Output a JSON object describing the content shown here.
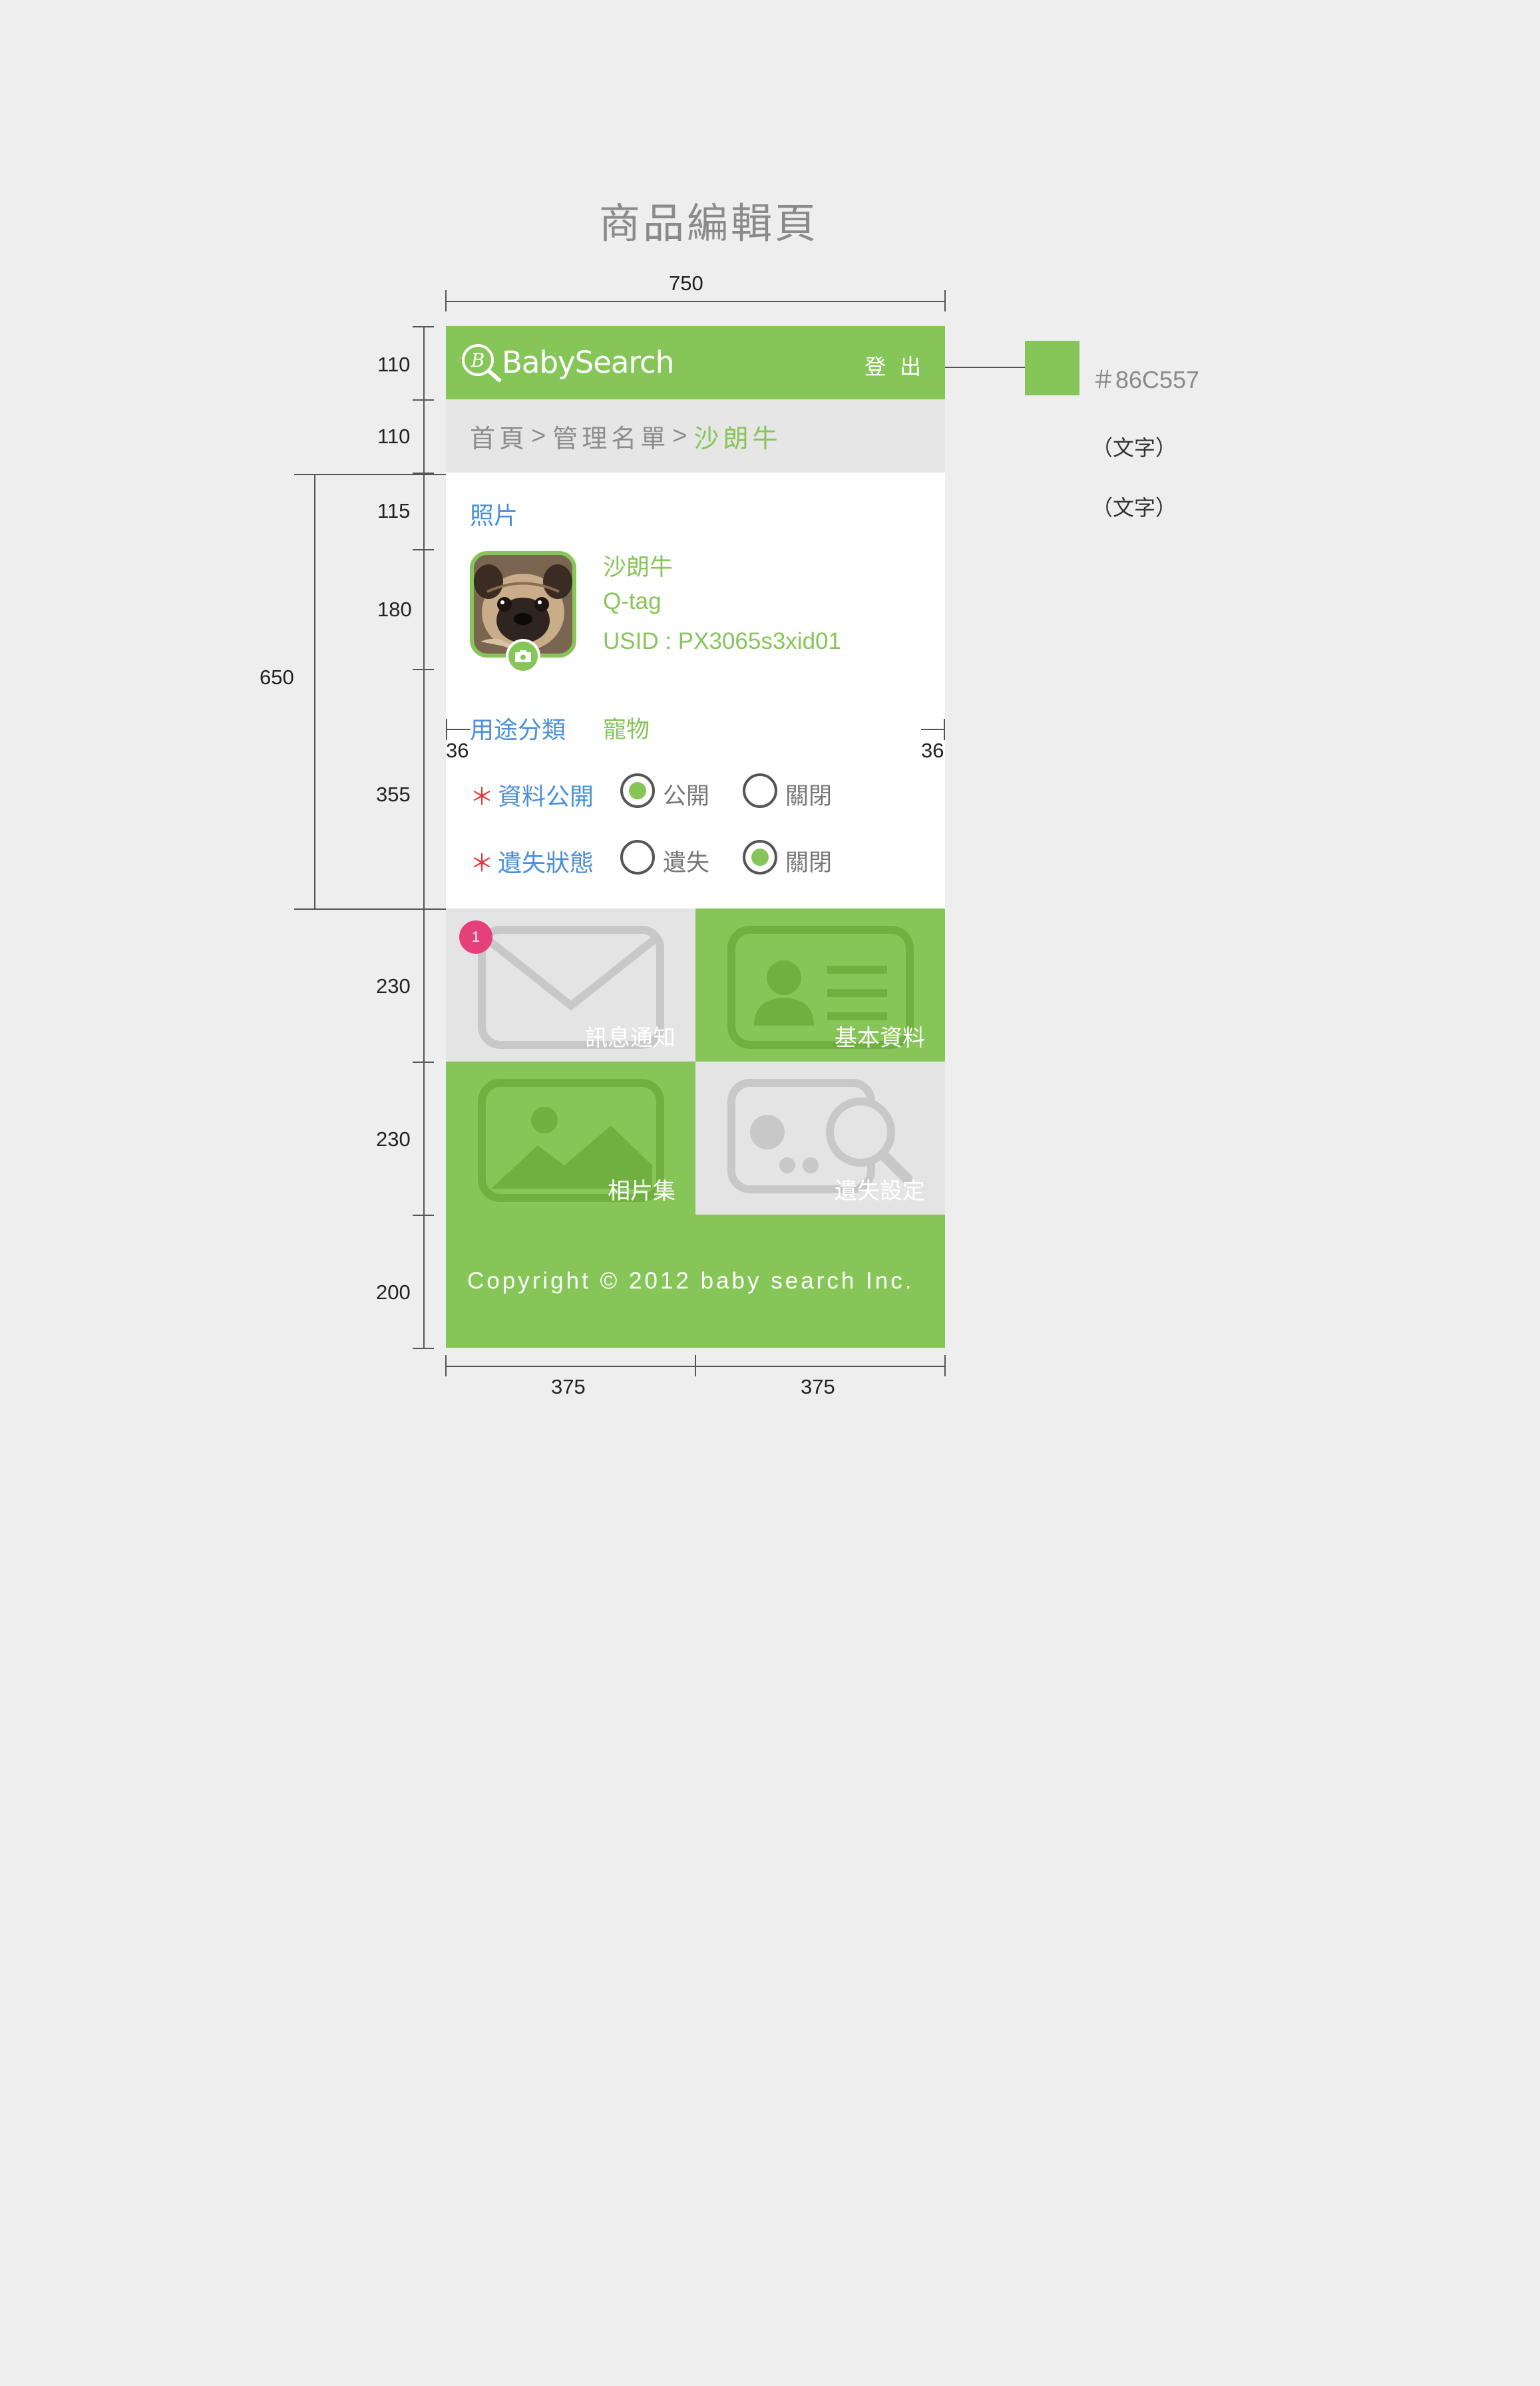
{
  "sheet": {
    "title": "商品編輯頁",
    "width_label": "750",
    "row_labels": [
      "110",
      "110",
      "115",
      "180",
      "355",
      "230",
      "230",
      "200"
    ],
    "span_label": "650",
    "padding_labels": [
      "36",
      "36"
    ],
    "column_labels": [
      "375",
      "375"
    ],
    "color_swatch": {
      "hex": "#86C557",
      "label": "＃86C557"
    },
    "notes": [
      "（文字）",
      "（文字）"
    ]
  },
  "header": {
    "logo_text": "BabySearch",
    "logout_label": "登 出"
  },
  "breadcrumb": {
    "items": [
      "首頁",
      "管理名單",
      "沙朗牛"
    ],
    "separator": ">"
  },
  "profile": {
    "photo_label": "照片",
    "name": "沙朗牛",
    "tag": "Q-tag",
    "usid": "USID : PX3065s3xid01",
    "category_label": "用途分類",
    "category_value": "寵物"
  },
  "settings": {
    "required_mark": "＊",
    "public": {
      "label": "資料公開",
      "options": [
        "公開",
        "關閉"
      ],
      "selected": 0
    },
    "lost": {
      "label": "遺失狀態",
      "options": [
        "遺失",
        "關閉"
      ],
      "selected": 1
    }
  },
  "tiles": [
    {
      "label": "訊息通知",
      "icon": "envelope-icon",
      "badge": "1"
    },
    {
      "label": "基本資料",
      "icon": "id-card-icon"
    },
    {
      "label": "相片集",
      "icon": "image-icon"
    },
    {
      "label": "遺失設定",
      "icon": "search-tag-icon"
    }
  ],
  "footer": {
    "copyright": "Copyright © 2012 baby search Inc."
  },
  "colors": {
    "brand_green": "#86C557",
    "link_blue": "#4a90d9",
    "badge_pink": "#e6407a",
    "required_red": "#e8383d"
  }
}
